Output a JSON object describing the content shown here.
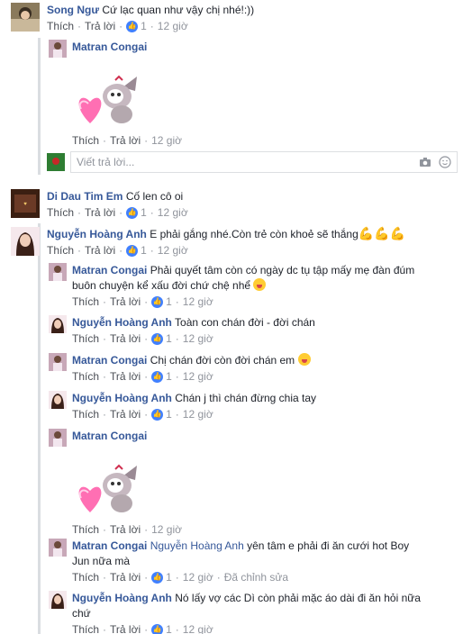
{
  "c1": {
    "author": "Song Ngư",
    "text": "Cứ lạc quan như vậy chị nhé!:))",
    "like": "Thích",
    "reply": "Trả lời",
    "likes": "1",
    "time": "12 giờ"
  },
  "r1": {
    "author": "Matran Congai",
    "like": "Thích",
    "reply": "Trả lời",
    "time": "12 giờ"
  },
  "reply_box": {
    "placeholder": "Viết trả lời..."
  },
  "c2": {
    "author": "Di Dau Tim Em",
    "text": "Cố len cô oi",
    "like": "Thích",
    "reply": "Trả lời",
    "likes": "1",
    "time": "12 giờ"
  },
  "c3": {
    "author": "Nguyễn Hoàng Anh",
    "text": "E phải gắng nhé.Còn trẻ còn khoẻ sẽ thắng",
    "like": "Thích",
    "reply": "Trả lời",
    "likes": "1",
    "time": "12 giờ"
  },
  "r2": {
    "author": "Matran Congai",
    "text1": "Phải quyết tâm còn có ngày dc tụ tập mấy mẹ đàn đúm",
    "text2": "buôn chuyện kể xấu đời chứ chệ nhể",
    "like": "Thích",
    "reply": "Trả lời",
    "likes": "1",
    "time": "12 giờ"
  },
  "r3": {
    "author": "Nguyễn Hoàng Anh",
    "text": "Toàn con chán đời - đời chán",
    "like": "Thích",
    "reply": "Trả lời",
    "likes": "1",
    "time": "12 giờ"
  },
  "r4": {
    "author": "Matran Congai",
    "text": "Chị chán đời còn đời chán em",
    "like": "Thích",
    "reply": "Trả lời",
    "likes": "1",
    "time": "12 giờ"
  },
  "r5": {
    "author": "Nguyễn Hoàng Anh",
    "text": "Chán j thì chán đừng chia tay",
    "like": "Thích",
    "reply": "Trả lời",
    "likes": "1",
    "time": "12 giờ"
  },
  "r6": {
    "author": "Matran Congai",
    "like": "Thích",
    "reply": "Trả lời",
    "time": "12 giờ"
  },
  "r7": {
    "author": "Matran Congai",
    "mention": "Nguyễn Hoàng Anh",
    "text1": "yên tâm e phải đi ăn cưới hot Boy",
    "text2": "Jun nữa mà",
    "like": "Thích",
    "reply": "Trả lời",
    "likes": "1",
    "time": "12 giờ",
    "edited": "Đã chỉnh sửa"
  },
  "r8": {
    "author": "Nguyễn Hoàng Anh",
    "text1": "Nó lấy vợ các Dì còn phải mặc áo dài đi ăn hỏi nữa",
    "text2": "chứ",
    "like": "Thích",
    "reply": "Trả lời",
    "likes": "1",
    "time": "12 giờ"
  },
  "colors": {
    "link": "#365899",
    "meta": "#90949c",
    "like_blue": "#4080ff"
  }
}
